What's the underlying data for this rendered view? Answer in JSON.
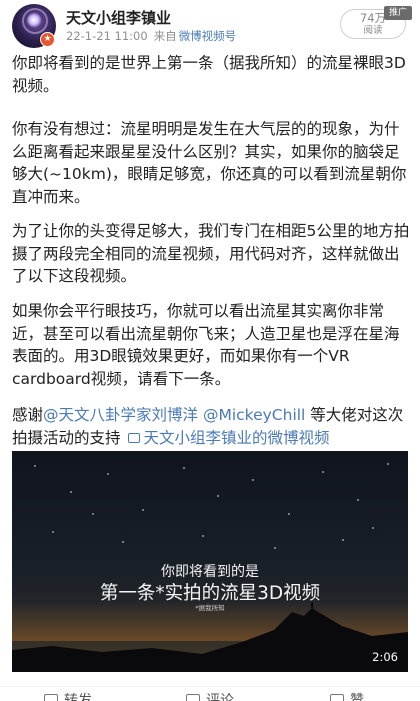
{
  "post": {
    "author": "天文小组李镇业",
    "date": "22-1-21 11:00",
    "source_prefix": "来自",
    "source_name": "微博视频号",
    "views_count": "74万",
    "views_label": "阅读",
    "promo_label": "推广"
  },
  "content": {
    "p1": "你即将看到的是世界上第一条（据我所知）的流星裸眼3D视频。",
    "p2": "你有没有想过：流星明明是发生在大气层的的现象，为什么距离看起来跟星星没什么区别？其实，如果你的脑袋足够大(~10km)，眼睛足够宽，你还真的可以看到流星朝你直冲而来。",
    "p3": "为了让你的头变得足够大，我们专门在相距5公里的地方拍摄了两段完全相同的流星视频，用代码对齐，这样就做出了以下这段视频。",
    "p4": "如果你会平行眼技巧，你就可以看出流星其实离你非常近，甚至可以看出流星朝你飞来；人造卫星也是浮在星海表面的。用3D眼镜效果更好，而如果你有一个VR cardboard视频，请看下一条。",
    "p5_prefix": "感谢",
    "p5_link1": "@天文八卦学家刘博洋",
    "p5_space": " ",
    "p5_link2": "@MickeyChill",
    "p5_mid": " 等大佬对这次拍摄活动的支持 ",
    "p5_video_link": "天文小组李镇业的微博视频"
  },
  "video": {
    "caption_line1": "你即将看到的是",
    "caption_line2": "第一条*实拍的流星3D视频",
    "caption_line3": "*据我所知",
    "duration": "2:06"
  },
  "actions": {
    "repost": "转发",
    "comment": "评论",
    "like": "赞"
  }
}
